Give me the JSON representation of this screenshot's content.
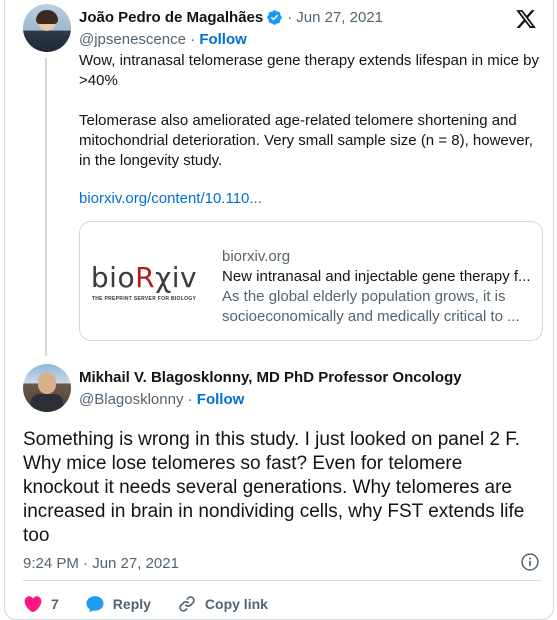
{
  "quoted_tweet": {
    "author_name": "João Pedro de Magalhães",
    "handle": "@jpsenescence",
    "follow_label": "Follow",
    "date": "Jun 27, 2021",
    "separator": "·",
    "paragraphs": [
      "Wow, intranasal telomerase gene therapy extends lifespan in mice by >40%",
      "Telomerase also ameliorated age-related telomere shortening and mitochondrial deterioration. Very small sample size (n = 8), however, in the longevity study."
    ],
    "link_text": "biorxiv.org/content/10.110...",
    "preview": {
      "logo_text_a": "bio",
      "logo_text_r": "R",
      "logo_text_b": "χiv",
      "logo_tagline": "THE PREPRINT SERVER FOR BIOLOGY",
      "domain": "biorxiv.org",
      "title": "New intranasal and injectable gene therapy f...",
      "description": "As the global elderly population grows, it is socioeconomically and medically critical to ..."
    }
  },
  "main_tweet": {
    "author_name": "Mikhail V. Blagosklonny, MD PhD Professor Oncology",
    "handle": "@Blagosklonny",
    "follow_label": "Follow",
    "separator": "·",
    "text": "Something is wrong in this study.  I just looked on panel 2 F. Why mice lose telomeres so fast? Even for telomere knockout it needs several generations. Why telomeres are increased in brain in nondividing cells, why FST extends life too",
    "timestamp": "9:24 PM · Jun 27, 2021"
  },
  "actions": {
    "like_count": "7",
    "reply_label": "Reply",
    "copy_label": "Copy link"
  },
  "colors": {
    "link": "#006fd6",
    "muted": "#536471",
    "like": "#f91880",
    "verified": "#1d9bf0"
  }
}
